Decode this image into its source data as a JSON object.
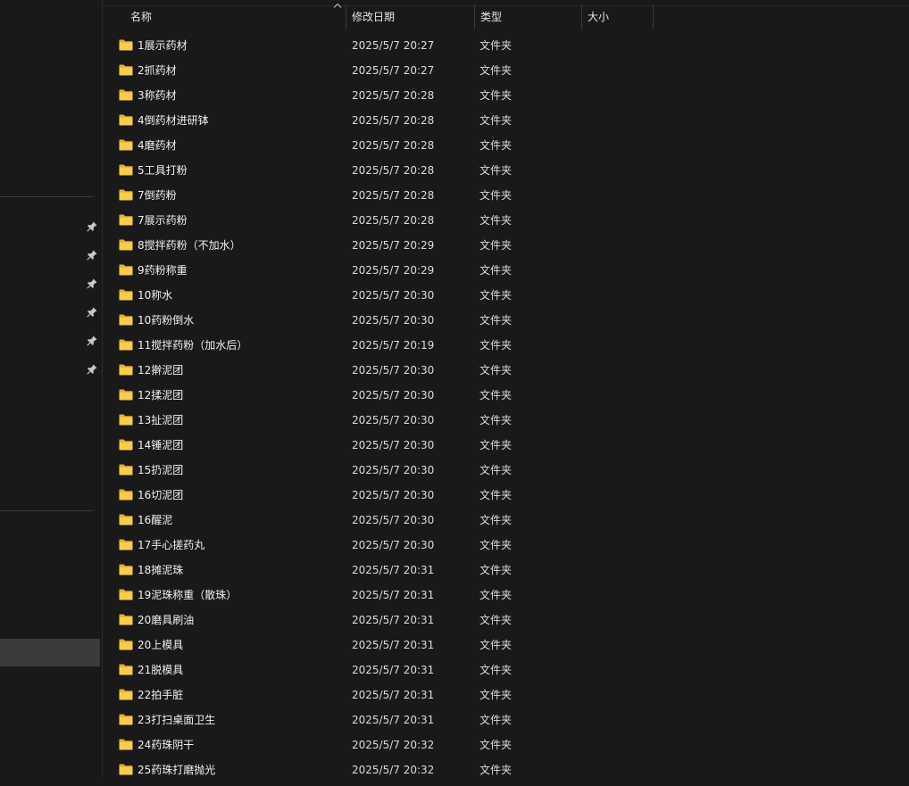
{
  "columns": {
    "name": "名称",
    "modified": "修改日期",
    "type": "类型",
    "size": "大小"
  },
  "sort": {
    "column": "name",
    "direction": "ascending"
  },
  "icons": {
    "folder": "folder-icon",
    "pin": "pin-icon",
    "sort": "sort-up-icon"
  },
  "colors": {
    "folder": "#f6c744",
    "background": "#191919",
    "selection": "#3b3b3b"
  },
  "files": [
    {
      "name": "1展示药材",
      "modified": "2025/5/7 20:27",
      "type": "文件夹",
      "size": ""
    },
    {
      "name": "2抓药材",
      "modified": "2025/5/7 20:27",
      "type": "文件夹",
      "size": ""
    },
    {
      "name": "3称药材",
      "modified": "2025/5/7 20:28",
      "type": "文件夹",
      "size": ""
    },
    {
      "name": "4倒药材进研钵",
      "modified": "2025/5/7 20:28",
      "type": "文件夹",
      "size": ""
    },
    {
      "name": "4磨药材",
      "modified": "2025/5/7 20:28",
      "type": "文件夹",
      "size": ""
    },
    {
      "name": "5工具打粉",
      "modified": "2025/5/7 20:28",
      "type": "文件夹",
      "size": ""
    },
    {
      "name": "7倒药粉",
      "modified": "2025/5/7 20:28",
      "type": "文件夹",
      "size": ""
    },
    {
      "name": "7展示药粉",
      "modified": "2025/5/7 20:28",
      "type": "文件夹",
      "size": ""
    },
    {
      "name": "8搅拌药粉（不加水）",
      "modified": "2025/5/7 20:29",
      "type": "文件夹",
      "size": ""
    },
    {
      "name": "9药粉称重",
      "modified": "2025/5/7 20:29",
      "type": "文件夹",
      "size": ""
    },
    {
      "name": "10称水",
      "modified": "2025/5/7 20:30",
      "type": "文件夹",
      "size": ""
    },
    {
      "name": "10药粉倒水",
      "modified": "2025/5/7 20:30",
      "type": "文件夹",
      "size": ""
    },
    {
      "name": "11搅拌药粉（加水后）",
      "modified": "2025/5/7 20:19",
      "type": "文件夹",
      "size": ""
    },
    {
      "name": "12擀泥团",
      "modified": "2025/5/7 20:30",
      "type": "文件夹",
      "size": ""
    },
    {
      "name": "12揉泥团",
      "modified": "2025/5/7 20:30",
      "type": "文件夹",
      "size": ""
    },
    {
      "name": "13扯泥团",
      "modified": "2025/5/7 20:30",
      "type": "文件夹",
      "size": ""
    },
    {
      "name": "14锤泥团",
      "modified": "2025/5/7 20:30",
      "type": "文件夹",
      "size": ""
    },
    {
      "name": "15扔泥团",
      "modified": "2025/5/7 20:30",
      "type": "文件夹",
      "size": ""
    },
    {
      "name": "16切泥团",
      "modified": "2025/5/7 20:30",
      "type": "文件夹",
      "size": ""
    },
    {
      "name": "16醒泥",
      "modified": "2025/5/7 20:30",
      "type": "文件夹",
      "size": ""
    },
    {
      "name": "17手心搓药丸",
      "modified": "2025/5/7 20:30",
      "type": "文件夹",
      "size": ""
    },
    {
      "name": "18摊泥珠",
      "modified": "2025/5/7 20:31",
      "type": "文件夹",
      "size": ""
    },
    {
      "name": "19泥珠称重（散珠）",
      "modified": "2025/5/7 20:31",
      "type": "文件夹",
      "size": ""
    },
    {
      "name": "20磨具刷油",
      "modified": "2025/5/7 20:31",
      "type": "文件夹",
      "size": ""
    },
    {
      "name": "20上模具",
      "modified": "2025/5/7 20:31",
      "type": "文件夹",
      "size": ""
    },
    {
      "name": "21脱模具",
      "modified": "2025/5/7 20:31",
      "type": "文件夹",
      "size": ""
    },
    {
      "name": "22拍手脏",
      "modified": "2025/5/7 20:31",
      "type": "文件夹",
      "size": ""
    },
    {
      "name": "23打扫桌面卫生",
      "modified": "2025/5/7 20:31",
      "type": "文件夹",
      "size": ""
    },
    {
      "name": "24药珠阴干",
      "modified": "2025/5/7 20:32",
      "type": "文件夹",
      "size": ""
    },
    {
      "name": "25药珠打磨抛光",
      "modified": "2025/5/7 20:32",
      "type": "文件夹",
      "size": ""
    }
  ]
}
